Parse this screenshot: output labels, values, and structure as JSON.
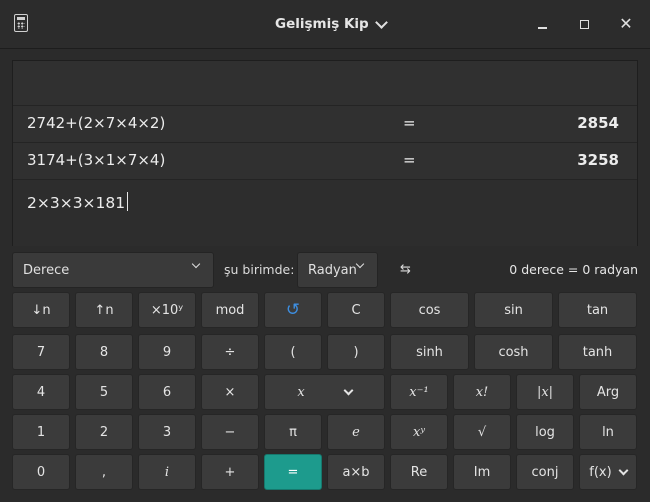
{
  "titlebar": {
    "title": "Gelişmiş Kip"
  },
  "window_buttons": {
    "close": "✕"
  },
  "history": [
    {
      "expression": "2742+(2×7×4×2)",
      "equals": "=",
      "result": "2854"
    },
    {
      "expression": "3174+(3×1×7×4)",
      "equals": "=",
      "result": "3258"
    }
  ],
  "input": {
    "current": "2×3×3×181"
  },
  "angle_bar": {
    "from_unit": "Derece",
    "to_label": "şu birimde:",
    "to_unit": "Radyan",
    "swap_symbol": "⇆",
    "conversion": "0 derece  =  0 radyan"
  },
  "keys": [
    [
      "↓n",
      "↑n",
      "×10ʸ",
      "mod",
      "↺",
      "C",
      "cos",
      "sin",
      "tan"
    ],
    [
      "7",
      "8",
      "9",
      "÷",
      "(",
      ")",
      "sinh",
      "cosh",
      "tanh"
    ],
    [
      "4",
      "5",
      "6",
      "×",
      "x",
      "x⁻¹",
      "x!",
      "|x|",
      "Arg"
    ],
    [
      "1",
      "2",
      "3",
      "−",
      "π",
      "e",
      "xʸ",
      "√",
      "log",
      "ln"
    ],
    [
      "0",
      ",",
      "i",
      "+",
      "=",
      "a×b",
      "Re",
      "Im",
      "conj",
      "f(x)"
    ]
  ]
}
